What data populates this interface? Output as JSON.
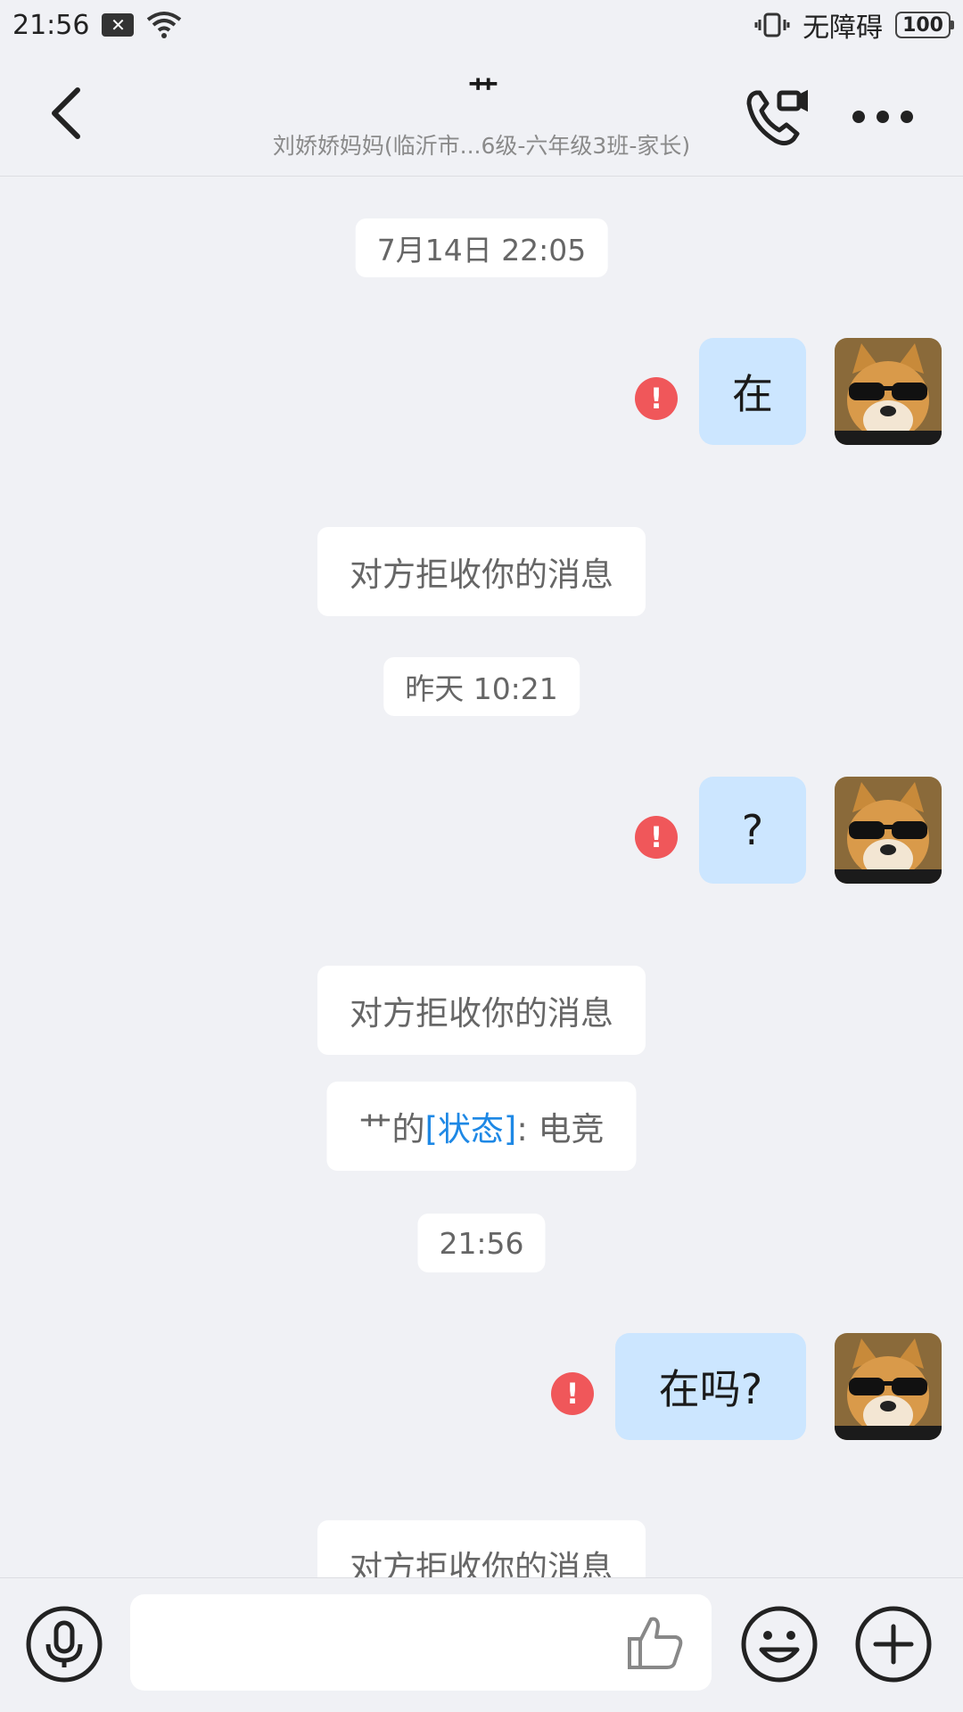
{
  "status_bar": {
    "time": "21:56",
    "notification_icon": "close-box-icon",
    "wifi_icon": "wifi-icon",
    "vibrate_icon": "vibrate-icon",
    "accessibility_text": "无障碍",
    "battery": "100"
  },
  "header": {
    "title": "艹",
    "subtitle": "刘娇娇妈妈(临沂市...6级-六年级3班-家长)",
    "back_icon": "chevron-left-icon",
    "call_icon": "phone-video-icon",
    "more_icon": "more-dots-icon"
  },
  "chat": {
    "timestamps": [
      "7月14日 22:05",
      "昨天 10:21",
      "21:56"
    ],
    "messages": [
      {
        "text": "在",
        "failed": true
      },
      {
        "text": "?",
        "failed": true
      },
      {
        "text": "在吗?",
        "failed": true
      }
    ],
    "system_messages": [
      "对方拒收你的消息",
      "对方拒收你的消息",
      "对方拒收你的消息"
    ],
    "status_notice": {
      "prefix": "艹的",
      "highlight": "[状态]",
      "suffix": ": 电竞"
    },
    "error_mark": "!",
    "accent_color": "#1e88e5",
    "bubble_color": "#cce6ff",
    "error_color": "#f0575a"
  },
  "input_bar": {
    "value": "",
    "voice_icon": "microphone-icon",
    "like_icon": "thumbs-up-icon",
    "emoji_icon": "smiley-icon",
    "plus_icon": "plus-icon"
  }
}
